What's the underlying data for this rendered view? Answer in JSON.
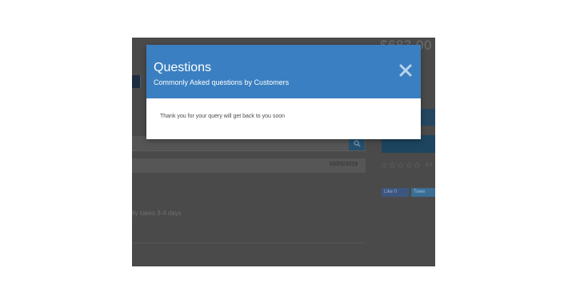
{
  "background_page": {
    "price": "$683.00",
    "review_date": "03/05/2019",
    "answer_text": "lly takes 3-4 days",
    "stars": "☆☆☆☆☆",
    "stars_trail": "0 r",
    "like_label": "Like 0",
    "tweet_label": "Twee"
  },
  "modal": {
    "title": "Questions",
    "subtitle": "Commonly Asked questions by Customers",
    "message": "Thank you for your query will get back to you soon",
    "close_icon": "close-icon"
  },
  "colors": {
    "overlay": "#4a4a4a",
    "modal_header": "#3a7fc1",
    "modal_body": "#ffffff"
  }
}
